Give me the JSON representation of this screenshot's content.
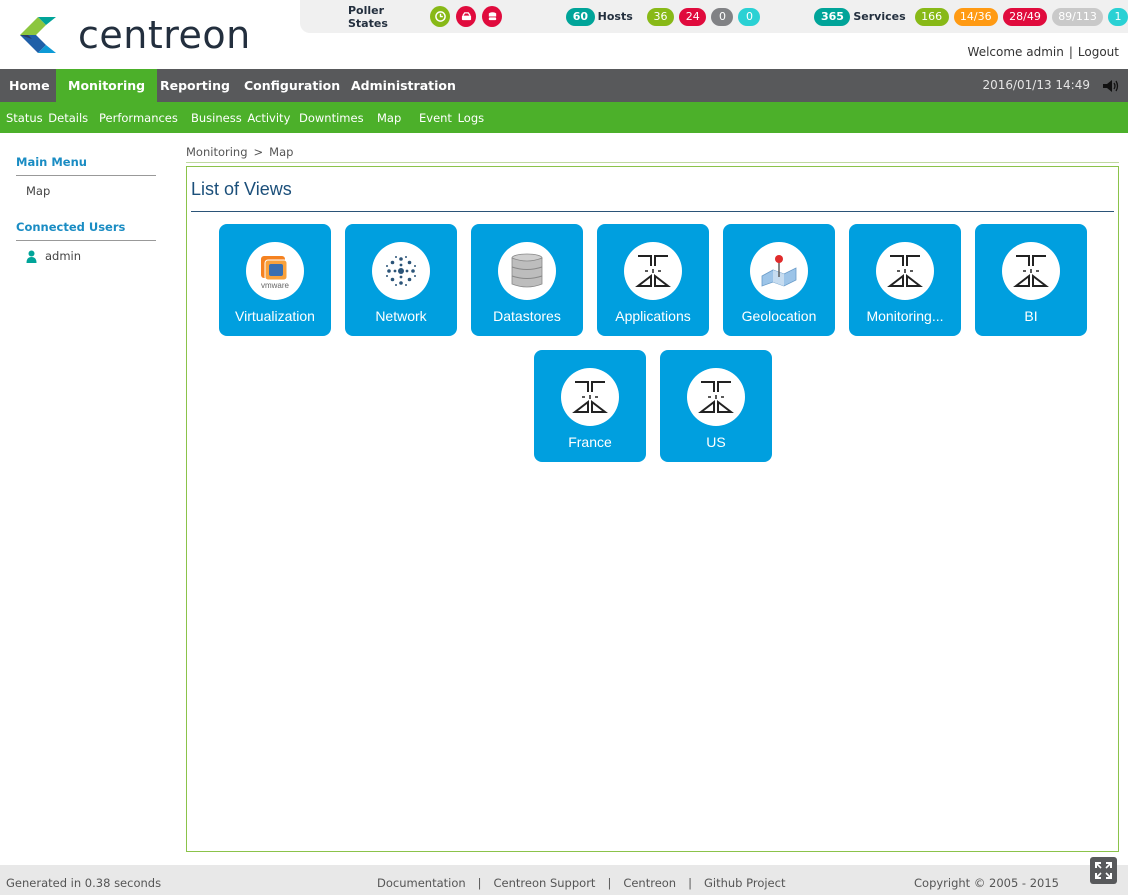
{
  "header": {
    "brand": "centreon",
    "poller_states_label": "Poller States",
    "hosts": {
      "total": "60",
      "label": "Hosts",
      "up": "36",
      "down": "24",
      "unreachable": "0",
      "pending": "0"
    },
    "services": {
      "total": "365",
      "label": "Services",
      "ok": "166",
      "warning": "14/36",
      "critical": "28/49",
      "unknown": "89/113",
      "pending": "1"
    },
    "welcome": "Welcome admin",
    "logout": "Logout",
    "colors": {
      "ok": "#88b917",
      "critical": "#e00b3d",
      "neutral": "#818285",
      "pending": "#2ad1d4",
      "warning": "#ff9a13",
      "total": "#00a499",
      "brand_green": "#4cb02a",
      "tile_blue": "#009fdf"
    }
  },
  "nav": {
    "items": [
      {
        "label": "Home"
      },
      {
        "label": "Monitoring"
      },
      {
        "label": "Reporting"
      },
      {
        "label": "Configuration"
      },
      {
        "label": "Administration"
      }
    ],
    "datetime": "2016/01/13 14:49"
  },
  "subnav": {
    "items": [
      {
        "label": "Status Details"
      },
      {
        "label": "Performances"
      },
      {
        "label": "Business Activity"
      },
      {
        "label": "Downtimes"
      },
      {
        "label": "Map"
      },
      {
        "label": "Event Logs"
      }
    ]
  },
  "sidebar": {
    "main_menu_title": "Main Menu",
    "main_menu_items": [
      {
        "label": "Map"
      }
    ],
    "users_title": "Connected Users",
    "users": [
      {
        "label": "admin"
      }
    ]
  },
  "breadcrumb": {
    "parent": "Monitoring",
    "current": "Map",
    "separator": ">"
  },
  "main": {
    "title": "List of Views",
    "views": [
      {
        "label": "Virtualization",
        "icon": "vmware-icon"
      },
      {
        "label": "Network",
        "icon": "network-icon"
      },
      {
        "label": "Datastores",
        "icon": "database-icon"
      },
      {
        "label": "Applications",
        "icon": "view-icon"
      },
      {
        "label": "Geolocation",
        "icon": "map-pin-icon"
      },
      {
        "label": "Monitoring...",
        "icon": "view-icon"
      },
      {
        "label": "BI",
        "icon": "view-icon"
      },
      {
        "label": "France",
        "icon": "view-icon"
      },
      {
        "label": "US",
        "icon": "view-icon"
      }
    ]
  },
  "footer": {
    "generated": "Generated in 0.38 seconds",
    "links": [
      {
        "label": "Documentation"
      },
      {
        "label": "Centreon Support"
      },
      {
        "label": "Centreon"
      },
      {
        "label": "Github Project"
      }
    ],
    "copyright": "Copyright © 2005 - 2015"
  }
}
